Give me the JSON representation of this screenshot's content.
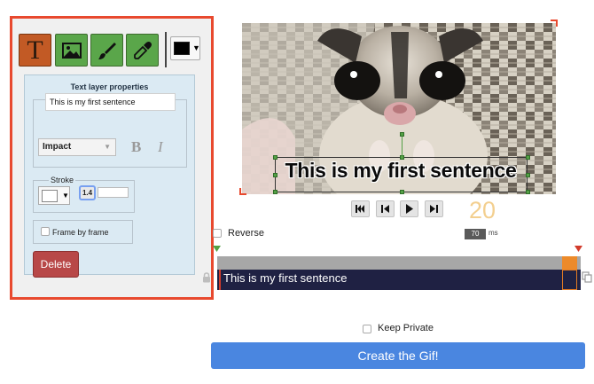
{
  "toolbar": {
    "tools": [
      "text-tool",
      "image-tool",
      "brush-tool",
      "eyedropper-tool"
    ],
    "text_tool_glyph": "T",
    "active_tool": "text-tool",
    "fill_color": "#000000"
  },
  "text_props": {
    "title": "Text layer properties",
    "text_value": "This is my first sentence",
    "font": "Impact",
    "bold_label": "B",
    "italic_label": "I",
    "stroke_legend": "Stroke",
    "stroke_color": "#ffffff",
    "stroke_width": "1.4",
    "frame_by_frame_label": "Frame by frame",
    "frame_by_frame_checked": false,
    "delete_label": "Delete"
  },
  "preview": {
    "caption": "This is my first sentence"
  },
  "playback": {
    "frame_number": "20",
    "reverse_label": "Reverse",
    "reverse_checked": false,
    "delay_value": "70",
    "delay_unit": "ms"
  },
  "timeline": {
    "layer_label": "This is my first sentence"
  },
  "footer": {
    "keep_private_label": "Keep Private",
    "keep_private_checked": false,
    "create_label": "Create the Gif!"
  },
  "colors": {
    "panel_border": "#e8492e",
    "active_tool": "#c25a25",
    "tool_green": "#5aa64a",
    "delete": "#b84848",
    "create": "#4a86e0",
    "timeline_layer": "#1f2143",
    "frame_number": "#f3cf8f"
  }
}
